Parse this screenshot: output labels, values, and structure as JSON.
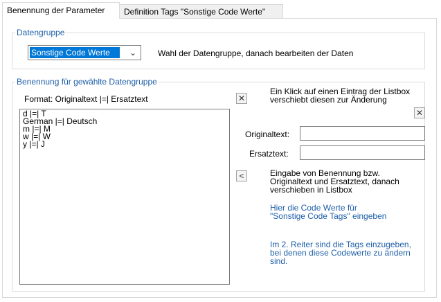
{
  "tabs": [
    {
      "label": "Benennung der Parameter"
    },
    {
      "label": "Definition Tags \"Sonstige Code Werte\""
    }
  ],
  "datengruppe": {
    "legend": "Datengruppe",
    "combo_value": "Sonstige Code Werte",
    "hint": "Wahl der Datengruppe, danach bearbeiten der Daten"
  },
  "benennung": {
    "legend": "Benennung für gewählte Datengruppe",
    "format_label": "Format: Originaltext |=| Ersatztext",
    "list_items": [
      "d |=|  T",
      "German |=| Deutsch",
      "m |=| M",
      "w |=| W",
      "y |=| J"
    ],
    "click_hint": [
      "Ein Klick auf einen Eintrag der Listbox",
      "verschiebt diesen zur Änderung"
    ],
    "original_label": "Originaltext:",
    "original_value": "",
    "ersatz_label": "Ersatztext:",
    "ersatz_value": "",
    "move_hint": [
      "Eingabe von Benennung bzw.",
      "Originaltext und Ersatztext, danach",
      "verschieben in Listbox"
    ],
    "blue_hint1": [
      "Hier die Code Werte für",
      "\"Sonstige Code Tags\" eingeben"
    ],
    "blue_hint2": [
      "Im 2. Reiter sind die Tags einzugeben,",
      "bei denen diese Codewerte zu ändern",
      "sind."
    ]
  },
  "buttons": {
    "delete_list": "✕",
    "clear_fields": "✕",
    "move_left": "<"
  },
  "colors": {
    "accent": "#1e5fa8",
    "selection": "#0078d7"
  }
}
